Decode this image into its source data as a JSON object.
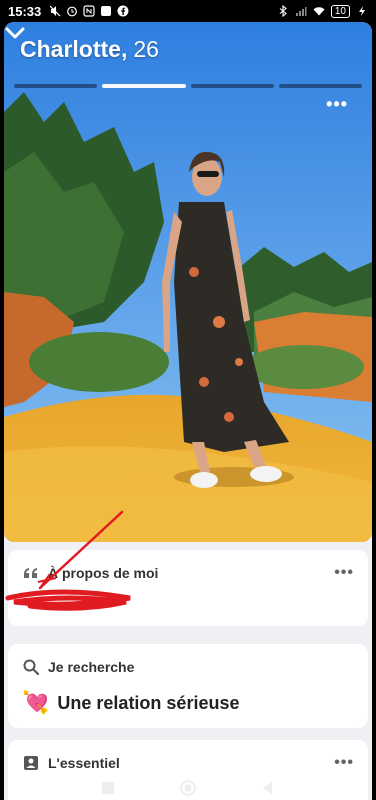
{
  "status_bar": {
    "time": "15:33",
    "battery": "10"
  },
  "profile": {
    "name": "Charlotte,",
    "age": "26",
    "photo_count": 4,
    "active_photo_index": 1
  },
  "about": {
    "title": "À propos de moi"
  },
  "looking_for": {
    "title": "Je recherche",
    "emoji": "💘",
    "value": "Une relation sérieuse"
  },
  "essentials": {
    "title": "L'essentiel"
  },
  "icons": {
    "collapse": "chevron-down-icon",
    "more": "more-options-icon",
    "quote": "quote-icon",
    "search": "search-icon",
    "badge": "id-badge-icon"
  },
  "colors": {
    "accent_white": "#ffffff",
    "sky": "#5aa0e6",
    "ochre": "#e3a22a",
    "scribble_red": "#e11b22"
  }
}
